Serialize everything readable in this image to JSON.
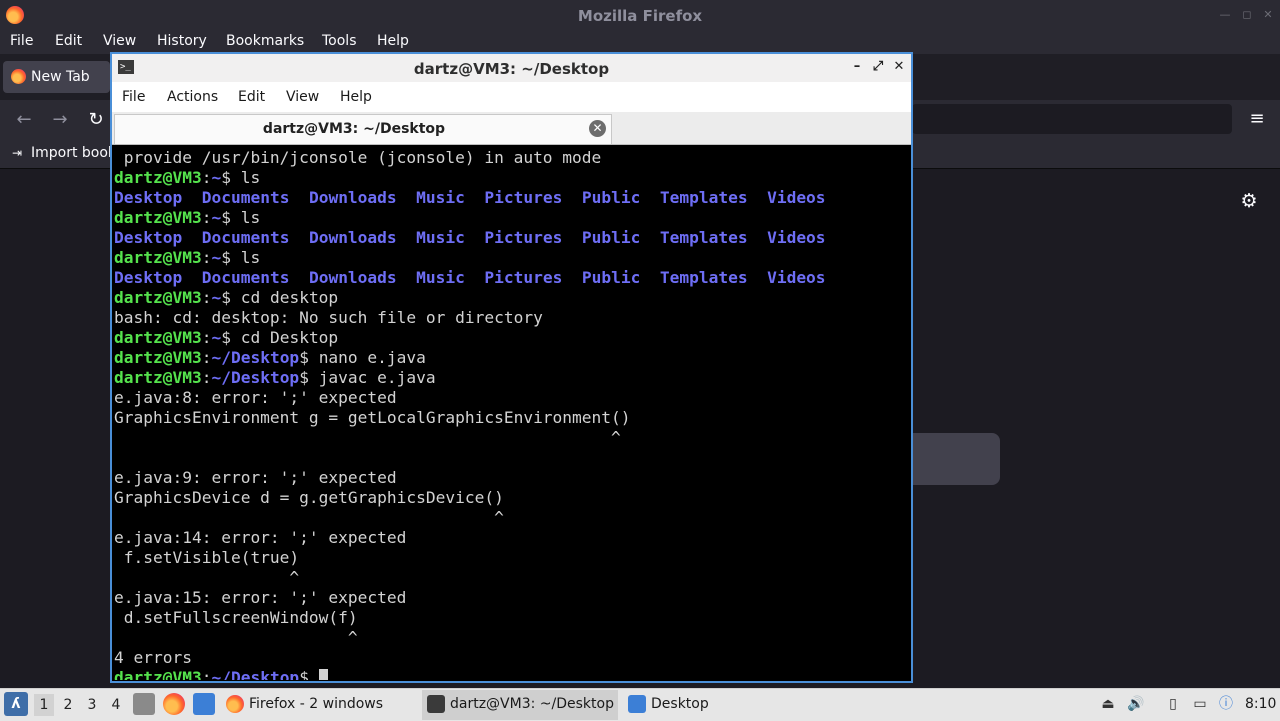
{
  "firefox": {
    "title": "Mozilla Firefox",
    "menu": [
      "File",
      "Edit",
      "View",
      "History",
      "Bookmarks",
      "Tools",
      "Help"
    ],
    "tab_label": "New Tab",
    "import_bookmarks": "Import book",
    "icons": {
      "back": "←",
      "forward": "→",
      "reload": "↻",
      "menu": "≡",
      "settings": "⚙",
      "import": "⇥"
    }
  },
  "terminal": {
    "title": "dartz@VM3: ~/Desktop",
    "menu": [
      "File",
      "Actions",
      "Edit",
      "View",
      "Help"
    ],
    "tab_label": "dartz@VM3: ~/Desktop",
    "close_glyph": "✕",
    "user_host": "dartz@VM3",
    "dirs": [
      "Desktop",
      "Documents",
      "Downloads",
      "Music",
      "Pictures",
      "Public",
      "Templates",
      "Videos"
    ],
    "lines": [
      " provide /usr/bin/jconsole (jconsole) in auto mode",
      "ls",
      "ls",
      "ls",
      "cd desktop",
      "bash: cd: desktop: No such file or directory",
      "cd Desktop",
      "nano e.java",
      "javac e.java",
      "e.java:8: error: ';' expected",
      "GraphicsEnvironment g = getLocalGraphicsEnvironment()",
      "                                                   ^",
      "e.java:9: error: ';' expected",
      "GraphicsDevice d = g.getGraphicsDevice()",
      "                                       ^",
      "e.java:14: error: ';' expected",
      " f.setVisible(true)",
      "                  ^",
      "e.java:15: error: ';' expected",
      " d.setFullscreenWindow(f)",
      "                        ^",
      "4 errors"
    ]
  },
  "taskbar": {
    "workspaces": [
      "1",
      "2",
      "3",
      "4"
    ],
    "tasks": [
      "Firefox - 2 windows",
      "dartz@VM3: ~/Desktop",
      "Desktop"
    ],
    "clock": "8:10"
  },
  "colors": {
    "terminal_user": "#55e34d",
    "terminal_path": "#6e6ef5",
    "terminal_text": "#d3d3d3",
    "window_border": "#4a8fd8"
  }
}
